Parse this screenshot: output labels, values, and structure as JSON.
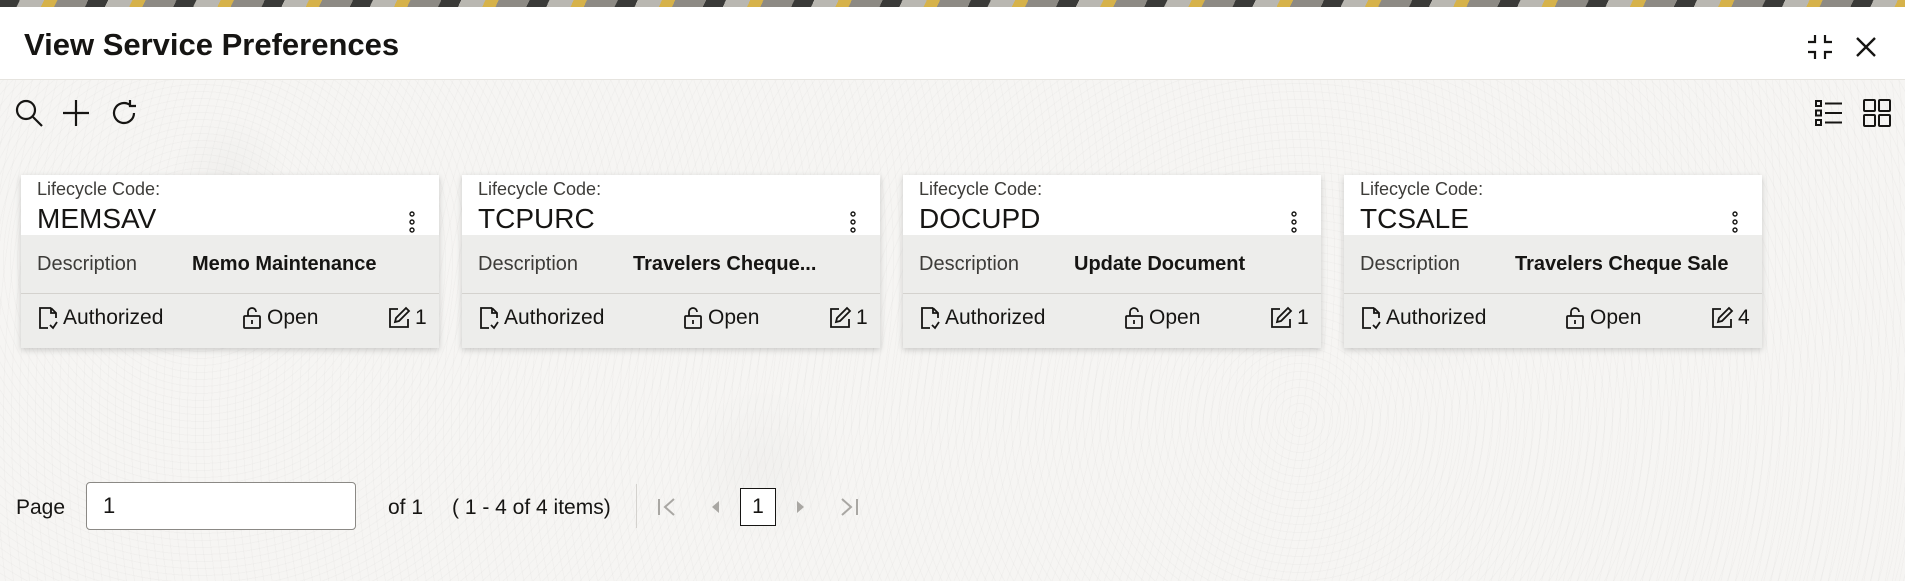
{
  "header": {
    "title": "View Service Preferences"
  },
  "cards": [
    {
      "lifecycle_label": "Lifecycle Code:",
      "code": "MEMSAV",
      "description_label": "Description",
      "description": "Memo Maintenance",
      "auth_status": "Authorized",
      "record_status": "Open",
      "version": "1"
    },
    {
      "lifecycle_label": "Lifecycle Code:",
      "code": "TCPURC",
      "description_label": "Description",
      "description": "Travelers Cheque...",
      "auth_status": "Authorized",
      "record_status": "Open",
      "version": "1"
    },
    {
      "lifecycle_label": "Lifecycle Code:",
      "code": "DOCUPD",
      "description_label": "Description",
      "description": "Update Document",
      "auth_status": "Authorized",
      "record_status": "Open",
      "version": "1"
    },
    {
      "lifecycle_label": "Lifecycle Code:",
      "code": "TCSALE",
      "description_label": "Description",
      "description": "Travelers Cheque Sale",
      "auth_status": "Authorized",
      "record_status": "Open",
      "version": "4"
    }
  ],
  "pagination": {
    "page_label": "Page",
    "page_value": "1",
    "of_label": "of 1",
    "items_label": "( 1 - 4 of 4 items)",
    "current_page": "1"
  },
  "icons": {
    "search": "search-icon",
    "add": "plus-icon",
    "refresh": "refresh-icon",
    "list_view": "list-view-icon",
    "tile_view": "tile-view-icon",
    "minimize": "minimize-icon",
    "close": "close-icon",
    "kebab": "kebab-icon",
    "authorized": "authorized-icon",
    "open": "unlock-icon",
    "edit": "edit-icon",
    "first": "first-page-icon",
    "prev": "previous-page-icon",
    "next": "next-page-icon",
    "last": "last-page-icon"
  },
  "colors": {
    "background": "#f6f5f3",
    "card": "#ffffff",
    "card_band": "#ededeb",
    "text": "#161513"
  }
}
